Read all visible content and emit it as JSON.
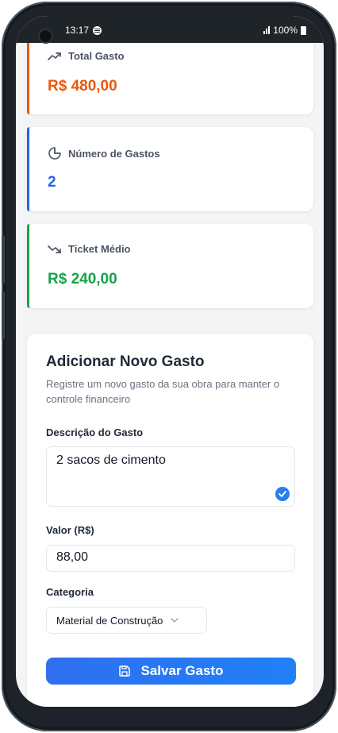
{
  "status_bar": {
    "time": "13:17",
    "battery": "100%"
  },
  "stats": [
    {
      "label": "Total Gasto",
      "value": "R$ 480,00",
      "icon": "trending-up-icon",
      "accent": "#ea580c"
    },
    {
      "label": "Número de Gastos",
      "value": "2",
      "icon": "pie-chart-icon",
      "accent": "#2563eb"
    },
    {
      "label": "Ticket Médio",
      "value": "R$ 240,00",
      "icon": "trending-down-icon",
      "accent": "#16a34a"
    }
  ],
  "form": {
    "title": "Adicionar Novo Gasto",
    "subtitle": "Registre um novo gasto da sua obra para manter o controle financeiro",
    "description_label": "Descrição do Gasto",
    "description_value": "2 sacos de cimento",
    "value_label": "Valor (R$)",
    "value_value": "88,00",
    "category_label": "Categoria",
    "category_value": "Material de Construção",
    "save_label": "Salvar Gasto"
  },
  "colors": {
    "primary": "#2f6ff0",
    "orange": "#ea580c",
    "blue": "#2563eb",
    "green": "#16a34a"
  }
}
